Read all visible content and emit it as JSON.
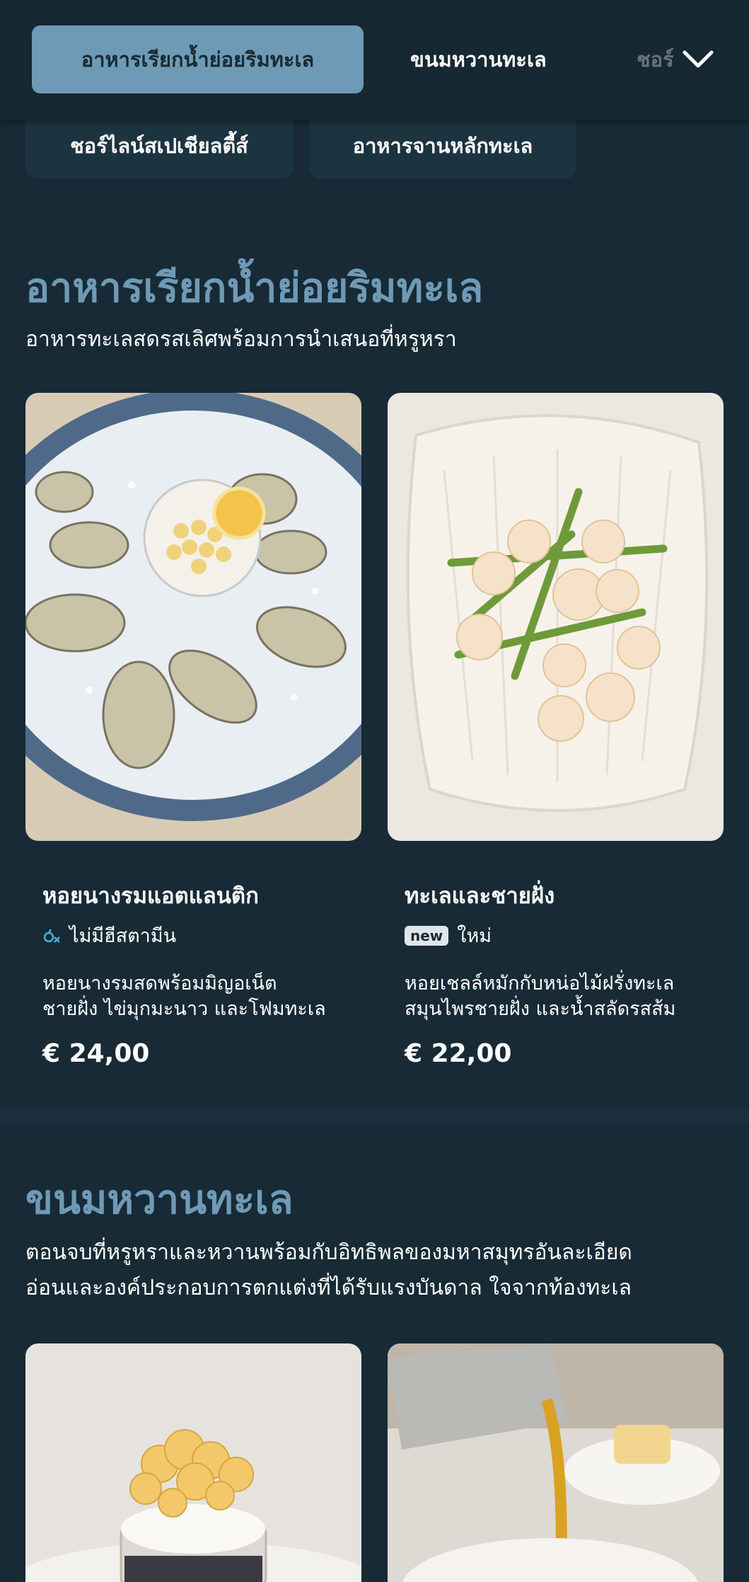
{
  "nav": {
    "tabs": [
      {
        "label": "อาหารเรียกน้ำย่อยริมทะเล",
        "active": true
      },
      {
        "label": "ขนมหวานทะเล",
        "active": false
      },
      {
        "label": "ชอร์ไลน์สเปเชียลตี้ส์",
        "active": false
      },
      {
        "label": "อาหารจานหลักทะเล",
        "active": false
      }
    ],
    "overflow_label": "ชอร์",
    "expand_icon": "chevron-down-icon"
  },
  "sections": [
    {
      "title": "อาหารเรียกน้ำย่อยริมทะเล",
      "subtitle": "อาหารทะเลสดรสเลิศพร้อมการนำเสนอที่หรูหรา",
      "items": [
        {
          "name": "หอยนางรมแอตแลนติก",
          "tag_icon": "no-histamine-icon",
          "tag": "ไม่มีฮีสตามีน",
          "desc_line1": "หอยนางรมสดพร้อมมิญอเน็ต",
          "desc_line2": "ชายฝั่ง ไข่มุกมะนาว และโฟมทะเล",
          "price": "€ 24,00"
        },
        {
          "name": "ทะเลและชายฝั่ง",
          "badge": "new",
          "tag": "ใหม่",
          "desc_line1": "หอยเชลล์หมักกับหน่อไม้ฝรั่งทะเล",
          "desc_line2": "สมุนไพรชายฝั่ง และน้ำสลัดรสส้ม",
          "price": "€ 22,00"
        }
      ]
    },
    {
      "title": "ขนมหวานทะเล",
      "subtitle_line1": "ตอนจบที่หรูหราและหวานพร้อมกับอิทธิพลของมหาสมุทรอันละเอียด",
      "subtitle_line2": "อ่อนและองค์ประกอบการตกแต่งที่ได้รับแรงบันดาล ใจจากท้องทะเล"
    }
  ],
  "colors": {
    "background": "#172a36",
    "accent": "#6f9ab5",
    "tag_icon": "#47b3e0"
  }
}
